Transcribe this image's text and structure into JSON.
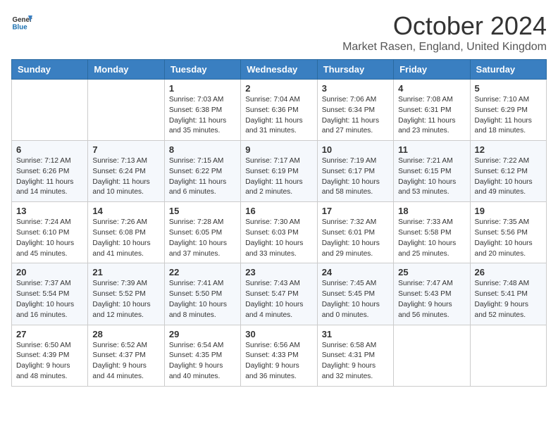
{
  "header": {
    "logo_general": "General",
    "logo_blue": "Blue",
    "title": "October 2024",
    "location": "Market Rasen, England, United Kingdom"
  },
  "days_of_week": [
    "Sunday",
    "Monday",
    "Tuesday",
    "Wednesday",
    "Thursday",
    "Friday",
    "Saturday"
  ],
  "weeks": [
    [
      null,
      null,
      {
        "day": 1,
        "sunrise": "7:03 AM",
        "sunset": "6:38 PM",
        "daylight": "11 hours and 35 minutes."
      },
      {
        "day": 2,
        "sunrise": "7:04 AM",
        "sunset": "6:36 PM",
        "daylight": "11 hours and 31 minutes."
      },
      {
        "day": 3,
        "sunrise": "7:06 AM",
        "sunset": "6:34 PM",
        "daylight": "11 hours and 27 minutes."
      },
      {
        "day": 4,
        "sunrise": "7:08 AM",
        "sunset": "6:31 PM",
        "daylight": "11 hours and 23 minutes."
      },
      {
        "day": 5,
        "sunrise": "7:10 AM",
        "sunset": "6:29 PM",
        "daylight": "11 hours and 18 minutes."
      }
    ],
    [
      {
        "day": 6,
        "sunrise": "7:12 AM",
        "sunset": "6:26 PM",
        "daylight": "11 hours and 14 minutes."
      },
      {
        "day": 7,
        "sunrise": "7:13 AM",
        "sunset": "6:24 PM",
        "daylight": "11 hours and 10 minutes."
      },
      {
        "day": 8,
        "sunrise": "7:15 AM",
        "sunset": "6:22 PM",
        "daylight": "11 hours and 6 minutes."
      },
      {
        "day": 9,
        "sunrise": "7:17 AM",
        "sunset": "6:19 PM",
        "daylight": "11 hours and 2 minutes."
      },
      {
        "day": 10,
        "sunrise": "7:19 AM",
        "sunset": "6:17 PM",
        "daylight": "10 hours and 58 minutes."
      },
      {
        "day": 11,
        "sunrise": "7:21 AM",
        "sunset": "6:15 PM",
        "daylight": "10 hours and 53 minutes."
      },
      {
        "day": 12,
        "sunrise": "7:22 AM",
        "sunset": "6:12 PM",
        "daylight": "10 hours and 49 minutes."
      }
    ],
    [
      {
        "day": 13,
        "sunrise": "7:24 AM",
        "sunset": "6:10 PM",
        "daylight": "10 hours and 45 minutes."
      },
      {
        "day": 14,
        "sunrise": "7:26 AM",
        "sunset": "6:08 PM",
        "daylight": "10 hours and 41 minutes."
      },
      {
        "day": 15,
        "sunrise": "7:28 AM",
        "sunset": "6:05 PM",
        "daylight": "10 hours and 37 minutes."
      },
      {
        "day": 16,
        "sunrise": "7:30 AM",
        "sunset": "6:03 PM",
        "daylight": "10 hours and 33 minutes."
      },
      {
        "day": 17,
        "sunrise": "7:32 AM",
        "sunset": "6:01 PM",
        "daylight": "10 hours and 29 minutes."
      },
      {
        "day": 18,
        "sunrise": "7:33 AM",
        "sunset": "5:58 PM",
        "daylight": "10 hours and 25 minutes."
      },
      {
        "day": 19,
        "sunrise": "7:35 AM",
        "sunset": "5:56 PM",
        "daylight": "10 hours and 20 minutes."
      }
    ],
    [
      {
        "day": 20,
        "sunrise": "7:37 AM",
        "sunset": "5:54 PM",
        "daylight": "10 hours and 16 minutes."
      },
      {
        "day": 21,
        "sunrise": "7:39 AM",
        "sunset": "5:52 PM",
        "daylight": "10 hours and 12 minutes."
      },
      {
        "day": 22,
        "sunrise": "7:41 AM",
        "sunset": "5:50 PM",
        "daylight": "10 hours and 8 minutes."
      },
      {
        "day": 23,
        "sunrise": "7:43 AM",
        "sunset": "5:47 PM",
        "daylight": "10 hours and 4 minutes."
      },
      {
        "day": 24,
        "sunrise": "7:45 AM",
        "sunset": "5:45 PM",
        "daylight": "10 hours and 0 minutes."
      },
      {
        "day": 25,
        "sunrise": "7:47 AM",
        "sunset": "5:43 PM",
        "daylight": "9 hours and 56 minutes."
      },
      {
        "day": 26,
        "sunrise": "7:48 AM",
        "sunset": "5:41 PM",
        "daylight": "9 hours and 52 minutes."
      }
    ],
    [
      {
        "day": 27,
        "sunrise": "6:50 AM",
        "sunset": "4:39 PM",
        "daylight": "9 hours and 48 minutes."
      },
      {
        "day": 28,
        "sunrise": "6:52 AM",
        "sunset": "4:37 PM",
        "daylight": "9 hours and 44 minutes."
      },
      {
        "day": 29,
        "sunrise": "6:54 AM",
        "sunset": "4:35 PM",
        "daylight": "9 hours and 40 minutes."
      },
      {
        "day": 30,
        "sunrise": "6:56 AM",
        "sunset": "4:33 PM",
        "daylight": "9 hours and 36 minutes."
      },
      {
        "day": 31,
        "sunrise": "6:58 AM",
        "sunset": "4:31 PM",
        "daylight": "9 hours and 32 minutes."
      },
      null,
      null
    ]
  ]
}
